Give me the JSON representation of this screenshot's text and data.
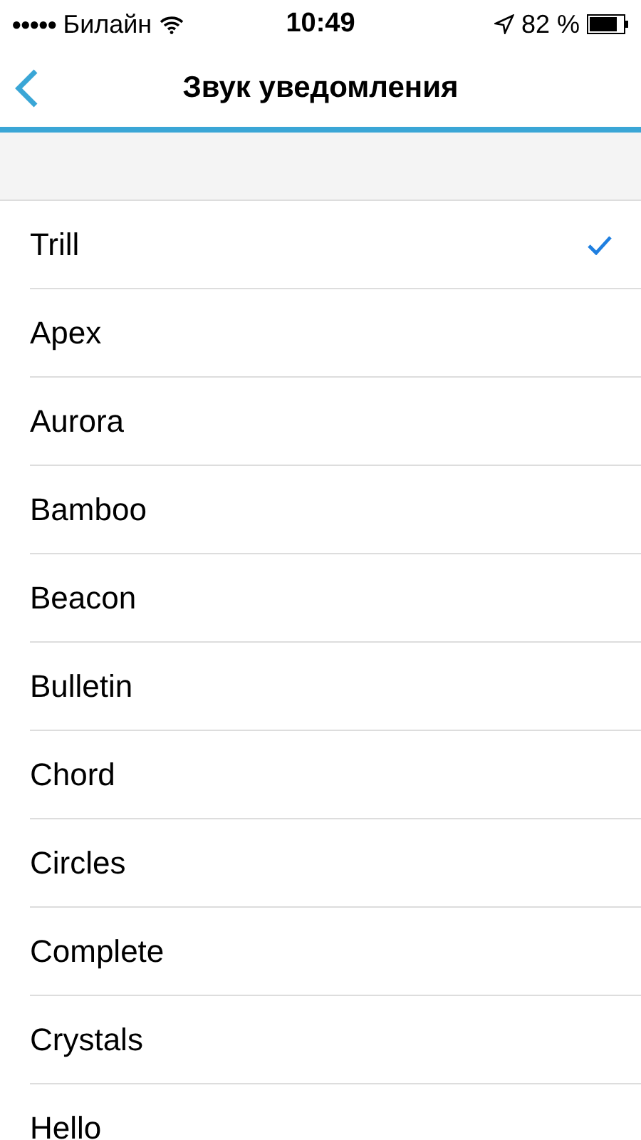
{
  "status_bar": {
    "signal_dots": "●●●●●",
    "carrier": "Билайн",
    "time": "10:49",
    "battery_text": "82 %"
  },
  "nav": {
    "title": "Звук уведомления"
  },
  "sounds": [
    {
      "name": "Trill",
      "selected": true
    },
    {
      "name": "Apex",
      "selected": false
    },
    {
      "name": "Aurora",
      "selected": false
    },
    {
      "name": "Bamboo",
      "selected": false
    },
    {
      "name": "Beacon",
      "selected": false
    },
    {
      "name": "Bulletin",
      "selected": false
    },
    {
      "name": "Chord",
      "selected": false
    },
    {
      "name": "Circles",
      "selected": false
    },
    {
      "name": "Complete",
      "selected": false
    },
    {
      "name": "Crystals",
      "selected": false
    },
    {
      "name": "Hello",
      "selected": false
    }
  ]
}
